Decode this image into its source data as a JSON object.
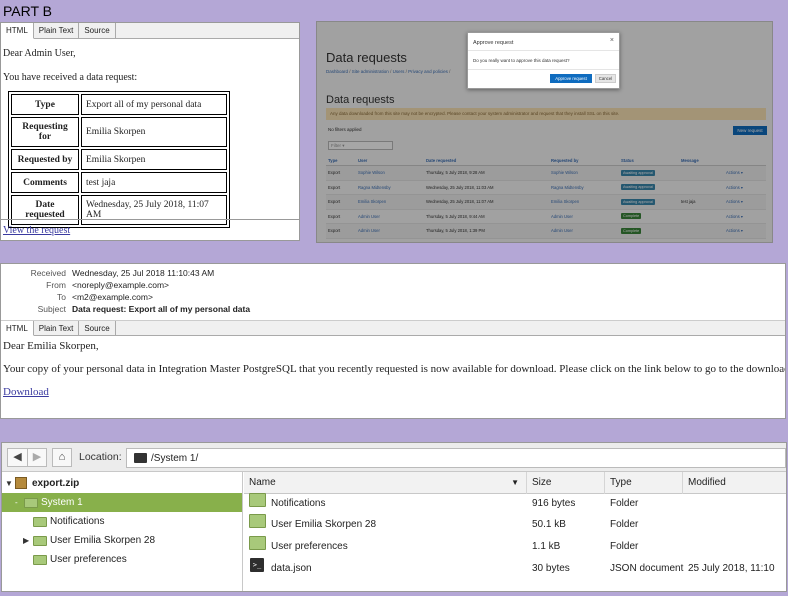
{
  "part_label": "PART B",
  "tabs": [
    "HTML",
    "Plain Text",
    "Source"
  ],
  "admin_email": {
    "greeting": "Dear Admin User,",
    "intro": "You have received a data request:",
    "rows": [
      {
        "key": "Type",
        "value": "Export all of my personal data"
      },
      {
        "key": "Requesting for",
        "value": "Emilia Skorpen"
      },
      {
        "key": "Requested by",
        "value": "Emilia Skorpen"
      },
      {
        "key": "Comments",
        "value": "test jaja"
      },
      {
        "key": "Date requested",
        "value": "Wednesday, 25 July 2018, 11:07 AM"
      }
    ],
    "link": "View the request"
  },
  "data_requests_page": {
    "title": "Data requests",
    "breadcrumb": [
      "Dashboard",
      "Site administration",
      "Users",
      "Privacy and policies"
    ],
    "heading": "Data requests",
    "warning": "Any data downloaded from this site may not be encrypted. Please contact your system administrator and request that they install SSL on this site.",
    "no_filters": "No filters applied",
    "new_request_label": "New request",
    "filter_placeholder": "Filter",
    "columns": [
      "Type",
      "User",
      "Date requested",
      "Requested by",
      "Status",
      "Message",
      ""
    ],
    "rows": [
      {
        "type": "Export",
        "user": "Sophie Wilson",
        "date": "Thursday, 5 July 2018, 9:28 AM",
        "by": "Sophie Wilson",
        "status": "Awaiting approval",
        "status_kind": "wait",
        "message": "",
        "actions": "Actions ▾"
      },
      {
        "type": "Export",
        "user": "Ragna Midtensby",
        "date": "Wednesday, 25 July 2018, 11:03 AM",
        "by": "Ragna Midtensby",
        "status": "Awaiting approval",
        "status_kind": "wait",
        "message": "",
        "actions": "Actions ▾"
      },
      {
        "type": "Export",
        "user": "Emilia Skorpen",
        "date": "Wednesday, 25 July 2018, 11:07 AM",
        "by": "Emilia Skorpen",
        "status": "Awaiting approval",
        "status_kind": "wait",
        "message": "test jaja",
        "actions": "Actions ▾"
      },
      {
        "type": "Export",
        "user": "Admin User",
        "date": "Thursday, 5 July 2018, 9:44 AM",
        "by": "Admin User",
        "status": "Complete",
        "status_kind": "done",
        "message": "",
        "actions": "Actions ▾"
      },
      {
        "type": "Export",
        "user": "Admin User",
        "date": "Thursday, 5 July 2018, 1:39 PM",
        "by": "Admin User",
        "status": "Complete",
        "status_kind": "done",
        "message": "",
        "actions": "Actions ▾"
      }
    ],
    "modal": {
      "title": "Approve request",
      "close": "×",
      "body": "Do you really want to approve this data request?",
      "approve_label": "Approve request",
      "cancel_label": "Cancel"
    }
  },
  "user_email": {
    "headers": [
      {
        "key": "Received",
        "value": "Wednesday, 25 Jul 2018 11:10:43 AM"
      },
      {
        "key": "From",
        "value": "<noreply@example.com>"
      },
      {
        "key": "To",
        "value": "<m2@example.com>"
      },
      {
        "key": "Subject",
        "value": "Data request: Export all of my personal data"
      }
    ],
    "greeting": "Dear Emilia Skorpen,",
    "body": "Your copy of your personal data in Integration Master PostgreSQL that you recently requested is now available for download. Please click on the link below to go to the download page.",
    "link": "Download"
  },
  "file_manager": {
    "back_icon": "back-arrow-icon",
    "forward_icon": "forward-arrow-icon",
    "home_icon": "home-icon",
    "location_label": "Location:",
    "location_value": "/System 1/",
    "tree": [
      {
        "label": "export.zip",
        "depth": 0,
        "expanded": true,
        "icon": "zip-icon"
      },
      {
        "label": "System 1",
        "depth": 1,
        "expanded": true,
        "selected": true,
        "icon": "folder-icon"
      },
      {
        "label": "Notifications",
        "depth": 2,
        "icon": "folder-icon"
      },
      {
        "label": "User Emilia Skorpen 28",
        "depth": 2,
        "expandable": true,
        "icon": "folder-icon"
      },
      {
        "label": "User preferences",
        "depth": 2,
        "icon": "folder-icon"
      }
    ],
    "columns": {
      "name": "Name",
      "size": "Size",
      "type": "Type",
      "modified": "Modified"
    },
    "files": [
      {
        "name": "Notifications",
        "size": "916 bytes",
        "type": "Folder",
        "modified": "",
        "icon": "folder-icon"
      },
      {
        "name": "User Emilia Skorpen 28",
        "size": "50.1 kB",
        "type": "Folder",
        "modified": "",
        "icon": "folder-icon"
      },
      {
        "name": "User preferences",
        "size": "1.1 kB",
        "type": "Folder",
        "modified": "",
        "icon": "folder-icon"
      },
      {
        "name": "data.json",
        "size": "30 bytes",
        "type": "JSON document",
        "modified": "25 July 2018, 11:10",
        "icon": "json-file-icon"
      }
    ],
    "colors": {
      "selection": "#88b04b",
      "folder": "#a8c97a"
    }
  },
  "colors": {
    "background": "#b4a7d6",
    "primary_button": "#0f6cbf"
  }
}
